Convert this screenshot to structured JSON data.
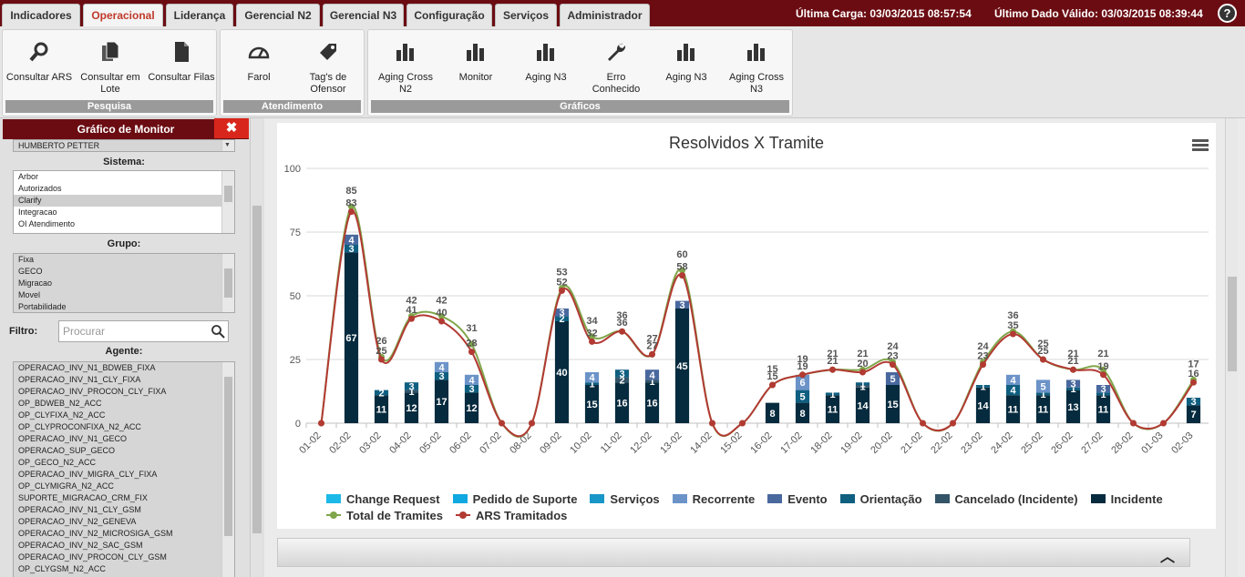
{
  "tabs": [
    {
      "label": "Indicadores"
    },
    {
      "label": "Operacional"
    },
    {
      "label": "Liderança"
    },
    {
      "label": "Gerencial N2"
    },
    {
      "label": "Gerencial N3"
    },
    {
      "label": "Configuração"
    },
    {
      "label": "Serviços"
    },
    {
      "label": "Administrador"
    }
  ],
  "status": {
    "ultima_carga": "Última Carga: 03/03/2015 08:57:54",
    "ultimo_dado": "Último Dado Válido: 03/03/2015 08:39:44",
    "help_label": "?"
  },
  "ribbon": {
    "pesquisa": {
      "label": "Pesquisa",
      "buttons": [
        {
          "label": "Consultar ARS",
          "icon": "search-icon"
        },
        {
          "label": "Consultar em Lote",
          "icon": "documents-icon"
        },
        {
          "label": "Consultar Filas",
          "icon": "document-icon"
        }
      ]
    },
    "atendimento": {
      "label": "Atendimento",
      "buttons": [
        {
          "label": "Farol",
          "icon": "gauge-icon"
        },
        {
          "label": "Tag's de Ofensor",
          "icon": "tag-icon"
        }
      ]
    },
    "graficos": {
      "label": "Gráficos",
      "buttons": [
        {
          "label": "Aging Cross N2",
          "icon": "bar-chart-icon"
        },
        {
          "label": "Monitor",
          "icon": "bar-chart-icon"
        },
        {
          "label": "Aging N3",
          "icon": "bar-chart-icon"
        },
        {
          "label": "Erro Conhecido",
          "icon": "wrench-icon"
        },
        {
          "label": "Aging N3",
          "icon": "bar-chart-icon"
        },
        {
          "label": "Aging Cross N3",
          "icon": "bar-chart-icon"
        }
      ]
    }
  },
  "sidebar": {
    "title": "Gráfico de Monitor",
    "close_label": "✖",
    "top_item": "HUMBERTO PETTER",
    "sistema": {
      "label": "Sistema:",
      "items": [
        "Arbor",
        "Autorizados",
        "Clarify",
        "Integracao",
        "OI Atendimento"
      ],
      "selected": "Clarify"
    },
    "grupo": {
      "label": "Grupo:",
      "items": [
        "Fixa",
        "GECO",
        "Migracao",
        "Movel",
        "Portabilidade"
      ]
    },
    "filtro": {
      "label": "Filtro:",
      "placeholder": "Procurar"
    },
    "agente": {
      "label": "Agente:",
      "items": [
        "OPERACAO_INV_N1_BDWEB_FIXA",
        "OPERACAO_INV_N1_CLY_FIXA",
        "OPERACAO_INV_PROCON_CLY_FIXA",
        "OP_BDWEB_N2_ACC",
        "OP_CLYFIXA_N2_ACC",
        "OP_CLYPROCONFIXA_N2_ACC",
        "OPERACAO_INV_N1_GECO",
        "OPERACAO_SUP_GECO",
        "OP_GECO_N2_ACC",
        "OPERACAO_INV_MIGRA_CLY_FIXA",
        "OP_CLYMIGRA_N2_ACC",
        "SUPORTE_MIGRACAO_CRM_FIX",
        "OPERACAO_INV_N1_CLY_GSM",
        "OPERACAO_INV_N2_GENEVA",
        "OPERACAO_INV_N2_MICROSIGA_GSM",
        "OPERACAO_INV_N2_SAC_GSM",
        "OPERACAO_INV_PROCON_CLY_GSM",
        "OP_CLYGSM_N2_ACC"
      ]
    }
  },
  "chart_data": {
    "type": "bar",
    "title": "Resolvidos X Tramite",
    "categories": [
      "01-02",
      "02-02",
      "03-02",
      "04-02",
      "05-02",
      "06-02",
      "07-02",
      "08-02",
      "09-02",
      "10-02",
      "11-02",
      "12-02",
      "13-02",
      "14-02",
      "15-02",
      "16-02",
      "17-02",
      "18-02",
      "19-02",
      "20-02",
      "21-02",
      "22-02",
      "23-02",
      "24-02",
      "25-02",
      "26-02",
      "27-02",
      "28-02",
      "01-03",
      "02-03"
    ],
    "ylim": [
      0,
      100
    ],
    "yticks": [
      0,
      25,
      50,
      75,
      100
    ],
    "grid": true,
    "legend_position": "bottom",
    "series": [
      {
        "name": "Change Request",
        "type": "bar",
        "color": "#1cb8e8",
        "values": [
          0,
          0,
          0,
          0,
          0,
          0,
          0,
          0,
          0,
          0,
          0,
          0,
          0,
          0,
          0,
          0,
          0,
          0,
          0,
          0,
          0,
          0,
          0,
          0,
          0,
          0,
          0,
          0,
          0,
          0
        ]
      },
      {
        "name": "Pedido de Suporte",
        "type": "bar",
        "color": "#10a8e0",
        "values": [
          0,
          0,
          0,
          0,
          0,
          0,
          0,
          0,
          0,
          0,
          0,
          0,
          0,
          0,
          0,
          0,
          0,
          0,
          0,
          0,
          0,
          0,
          0,
          0,
          0,
          0,
          0,
          0,
          0,
          0
        ]
      },
      {
        "name": "Serviços",
        "type": "bar",
        "color": "#1896c8",
        "values": [
          0,
          0,
          0,
          0,
          0,
          0,
          0,
          0,
          0,
          0,
          0,
          0,
          0,
          0,
          0,
          0,
          0,
          0,
          0,
          0,
          0,
          0,
          0,
          0,
          0,
          0,
          0,
          0,
          0,
          0
        ]
      },
      {
        "name": "Recorrente",
        "type": "bar",
        "color": "#6b93c8",
        "values": [
          0,
          0,
          0,
          0,
          4,
          4,
          0,
          0,
          0,
          4,
          0,
          0,
          0,
          0,
          0,
          0,
          6,
          0,
          0,
          0,
          0,
          0,
          0,
          4,
          5,
          0,
          0,
          0,
          0,
          0
        ]
      },
      {
        "name": "Evento",
        "type": "bar",
        "color": "#49689e",
        "values": [
          0,
          4,
          0,
          0,
          0,
          0,
          0,
          0,
          3,
          0,
          0,
          4,
          3,
          0,
          0,
          0,
          0,
          0,
          0,
          5,
          0,
          0,
          0,
          0,
          0,
          3,
          3,
          0,
          0,
          0
        ]
      },
      {
        "name": "Orientação",
        "type": "bar",
        "color": "#0f5f80",
        "values": [
          0,
          3,
          2,
          3,
          3,
          3,
          0,
          0,
          2,
          1,
          3,
          0,
          0,
          0,
          0,
          0,
          5,
          1,
          1,
          0,
          0,
          0,
          1,
          4,
          1,
          1,
          1,
          0,
          0,
          3
        ]
      },
      {
        "name": "Cancelado (Incidente)",
        "type": "bar",
        "color": "#345468",
        "values": [
          0,
          0,
          0,
          1,
          0,
          0,
          0,
          0,
          0,
          0,
          2,
          1,
          0,
          0,
          0,
          0,
          0,
          0,
          1,
          0,
          0,
          0,
          0,
          0,
          0,
          0,
          0,
          0,
          0,
          0
        ]
      },
      {
        "name": "Incidente",
        "type": "bar",
        "color": "#062b3e",
        "values": [
          0,
          67,
          11,
          12,
          17,
          12,
          0,
          0,
          40,
          15,
          16,
          16,
          45,
          0,
          0,
          8,
          8,
          11,
          14,
          15,
          0,
          0,
          14,
          11,
          11,
          13,
          11,
          0,
          0,
          7
        ]
      },
      {
        "name": "Total de Tramites",
        "type": "line",
        "color": "#7fa64a",
        "values": [
          0,
          85,
          26,
          42,
          42,
          31,
          0,
          0,
          53,
          34,
          36,
          27,
          60,
          0,
          0,
          15,
          19,
          21,
          21,
          24,
          0,
          0,
          24,
          36,
          25,
          21,
          21,
          0,
          0,
          17
        ]
      },
      {
        "name": "ARS Tramitados",
        "type": "line",
        "color": "#b23a33",
        "values": [
          0,
          83,
          25,
          41,
          40,
          28,
          0,
          0,
          52,
          32,
          36,
          27,
          58,
          0,
          0,
          15,
          19,
          21,
          20,
          23,
          0,
          0,
          23,
          35,
          25,
          21,
          19,
          0,
          0,
          16
        ]
      }
    ]
  }
}
